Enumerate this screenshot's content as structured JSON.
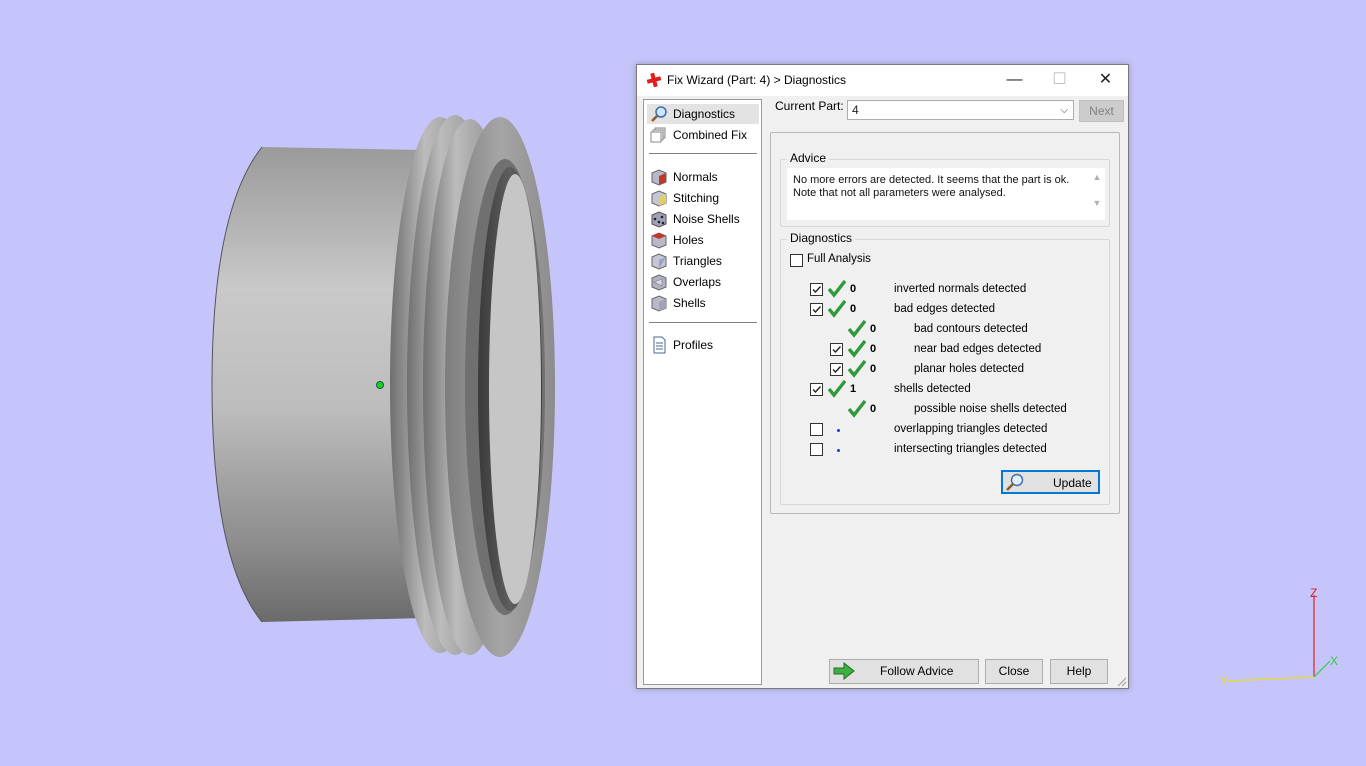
{
  "dialog": {
    "title": "Fix Wizard (Part: 4) > Diagnostics",
    "window_buttons": {
      "minimize": "—",
      "maximize": "☐",
      "close": "✕"
    }
  },
  "nav": {
    "items": [
      {
        "label": "Diagnostics",
        "icon": "magnifier-icon",
        "selected": true
      },
      {
        "label": "Combined Fix",
        "icon": "combined-fix-icon"
      },
      {
        "label": "Normals",
        "icon": "normals-cube-icon"
      },
      {
        "label": "Stitching",
        "icon": "stitching-cube-icon"
      },
      {
        "label": "Noise Shells",
        "icon": "noise-shells-icon"
      },
      {
        "label": "Holes",
        "icon": "holes-cube-icon"
      },
      {
        "label": "Triangles",
        "icon": "triangles-cube-icon"
      },
      {
        "label": "Overlaps",
        "icon": "overlaps-cube-icon"
      },
      {
        "label": "Shells",
        "icon": "shells-cube-icon"
      },
      {
        "label": "Profiles",
        "icon": "document-icon"
      }
    ]
  },
  "current_part": {
    "label": "Current Part:",
    "value": "4",
    "next_label": "Next"
  },
  "advice": {
    "title": "Advice",
    "line1": "No more errors are detected. It seems that the part is ok.",
    "line2": "Note that not all parameters were analysed."
  },
  "diagnostics": {
    "title": "Diagnostics",
    "full_analysis_label": "Full Analysis",
    "full_analysis_checked": false,
    "rows": [
      {
        "checkbox": true,
        "checked": true,
        "status": "ok",
        "count": "0",
        "label": "inverted normals detected",
        "indent": 0
      },
      {
        "checkbox": true,
        "checked": true,
        "status": "ok",
        "count": "0",
        "label": "bad edges detected",
        "indent": 0
      },
      {
        "checkbox": false,
        "checked": false,
        "status": "ok",
        "count": "0",
        "label": "bad contours detected",
        "indent": 1
      },
      {
        "checkbox": true,
        "checked": true,
        "status": "ok",
        "count": "0",
        "label": "near bad edges detected",
        "indent": 1
      },
      {
        "checkbox": true,
        "checked": true,
        "status": "ok",
        "count": "0",
        "label": "planar holes detected",
        "indent": 1
      },
      {
        "checkbox": true,
        "checked": true,
        "status": "ok",
        "count": "1",
        "label": "shells detected",
        "indent": 0
      },
      {
        "checkbox": false,
        "checked": false,
        "status": "ok",
        "count": "0",
        "label": "possible noise shells detected",
        "indent": 1
      },
      {
        "checkbox": true,
        "checked": false,
        "status": "pending",
        "count": "",
        "label": "overlapping triangles detected",
        "indent": 0
      },
      {
        "checkbox": true,
        "checked": false,
        "status": "pending",
        "count": "",
        "label": "intersecting triangles detected",
        "indent": 0
      }
    ],
    "update_label": "Update"
  },
  "footer": {
    "follow_advice": "Follow Advice",
    "close": "Close",
    "help": "Help"
  },
  "axis": {
    "z": "Z",
    "x": "X",
    "y": "Y"
  },
  "colors": {
    "viewport_bg": "#c5c5fb",
    "tick_green": "#2e9a3b",
    "accent_blue": "#0078d7",
    "axis_z": "#e02020",
    "axis_x": "#2ecc40",
    "axis_y": "#e8e020"
  }
}
